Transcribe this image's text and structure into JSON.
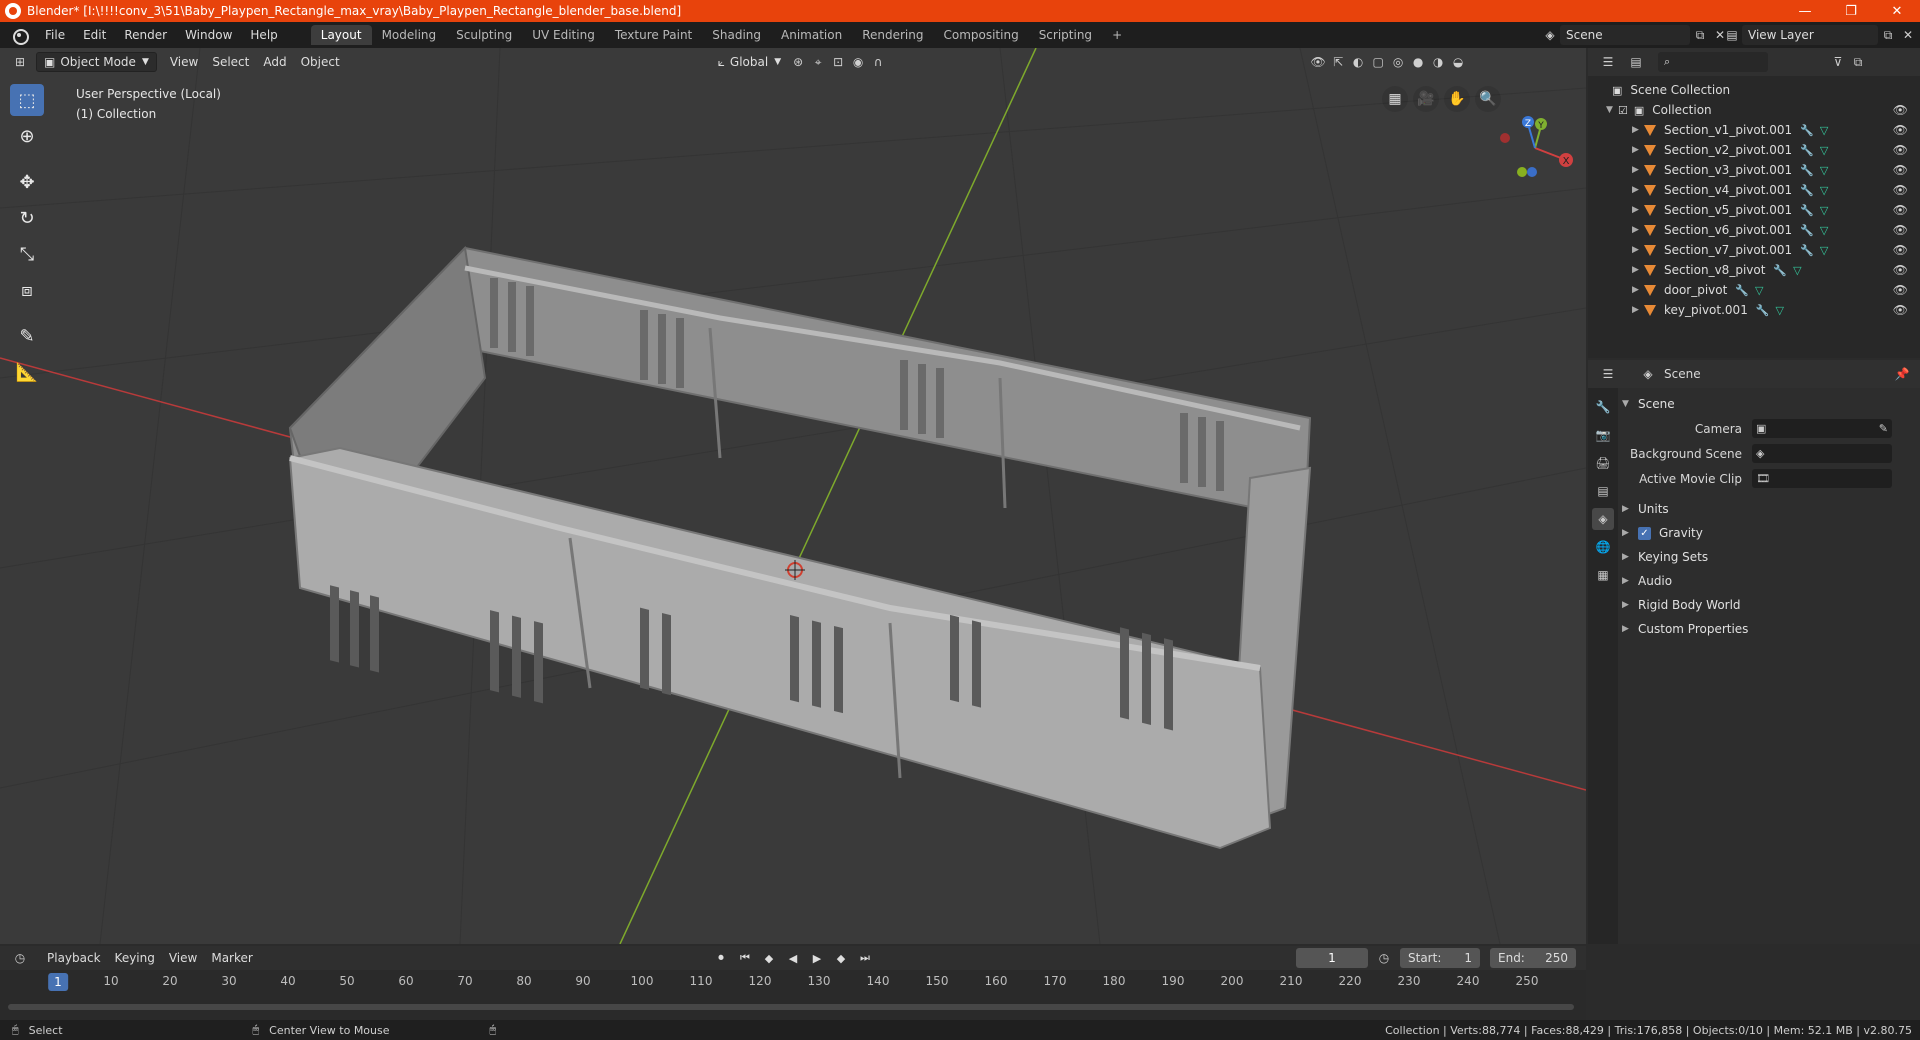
{
  "window": {
    "title": "Blender* [I:\\!!!!conv_3\\51\\Baby_Playpen_Rectangle_max_vray\\Baby_Playpen_Rectangle_blender_base.blend]",
    "minimize": "—",
    "maximize": "❐",
    "close": "✕"
  },
  "menubar": {
    "menus": [
      "File",
      "Edit",
      "Render",
      "Window",
      "Help"
    ],
    "workspaces": [
      "Layout",
      "Modeling",
      "Sculpting",
      "UV Editing",
      "Texture Paint",
      "Shading",
      "Animation",
      "Rendering",
      "Compositing",
      "Scripting"
    ],
    "active_workspace": "Layout",
    "add_tab": "+",
    "scene": "Scene",
    "view_layer": "View Layer"
  },
  "viewport": {
    "mode": "Object Mode",
    "menus": [
      "View",
      "Select",
      "Add",
      "Object"
    ],
    "transform_orientation": "Global",
    "info_line1": "User Perspective (Local)",
    "info_line2": "(1) Collection",
    "gizmo": {
      "x": "X",
      "y": "Y",
      "z": "Z"
    },
    "colors": {
      "bg": "#3a3a3a",
      "x_axis": "#b83a3a",
      "y_axis": "#7ea92c",
      "model": "#a9a9a9"
    }
  },
  "outliner": {
    "root": "Scene Collection",
    "collection": "Collection",
    "objects": [
      "Section_v1_pivot.001",
      "Section_v2_pivot.001",
      "Section_v3_pivot.001",
      "Section_v4_pivot.001",
      "Section_v5_pivot.001",
      "Section_v6_pivot.001",
      "Section_v7_pivot.001",
      "Section_v8_pivot",
      "door_pivot",
      "key_pivot.001"
    ]
  },
  "properties": {
    "header": "Scene",
    "panel": "Scene",
    "camera_label": "Camera",
    "background_scene_label": "Background Scene",
    "active_clip_label": "Active Movie Clip",
    "sections": [
      "Units",
      "Gravity",
      "Keying Sets",
      "Audio",
      "Rigid Body World",
      "Custom Properties"
    ],
    "gravity_checked": true
  },
  "timeline": {
    "menus": [
      "Playback",
      "Keying",
      "View",
      "Marker"
    ],
    "current_frame": "1",
    "start_label": "Start:",
    "start": "1",
    "end_label": "End:",
    "end": "250",
    "ticks": [
      "10",
      "20",
      "30",
      "40",
      "50",
      "60",
      "70",
      "80",
      "90",
      "100",
      "110",
      "120",
      "130",
      "140",
      "150",
      "160",
      "170",
      "180",
      "190",
      "200",
      "210",
      "220",
      "230",
      "240",
      "250"
    ]
  },
  "statusbar": {
    "select": "Select",
    "center_view": "Center View to Mouse",
    "stats": "Collection | Verts:88,774 | Faces:88,429 | Tris:176,858 | Objects:0/10 | Mem: 52.1 MB | v2.80.75"
  }
}
